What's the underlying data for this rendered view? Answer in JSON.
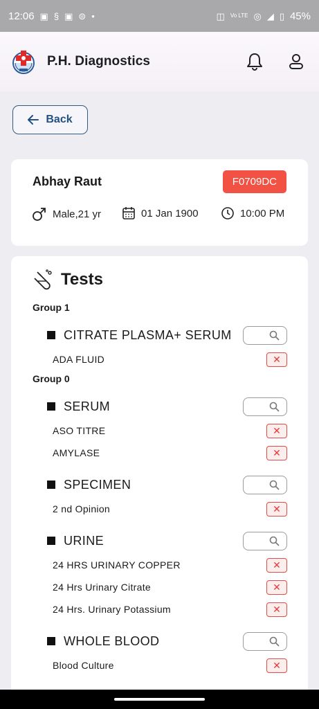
{
  "status_bar": {
    "time": "12:06",
    "battery": "45%",
    "network_label": "Vo LTE"
  },
  "app": {
    "title": "P.H. Diagnostics"
  },
  "back_label": "Back",
  "patient": {
    "name": "Abhay Raut",
    "id": "F0709DC",
    "gender_age": "Male,21 yr",
    "date": "01 Jan 1900",
    "time": "10:00 PM"
  },
  "tests": {
    "title": "Tests",
    "groups": [
      {
        "label": "Group 1",
        "samples": [
          {
            "name": "CITRATE PLASMA+ SERUM",
            "tests": [
              "ADA FLUID"
            ]
          }
        ]
      },
      {
        "label": "Group 0",
        "samples": [
          {
            "name": "SERUM",
            "tests": [
              "ASO TITRE",
              "AMYLASE"
            ]
          },
          {
            "name": "SPECIMEN",
            "tests": [
              "2 nd Opinion"
            ]
          },
          {
            "name": "URINE",
            "tests": [
              "24 HRS URINARY COPPER",
              "24 Hrs Urinary Citrate",
              "24 Hrs. Urinary Potassium"
            ]
          },
          {
            "name": "WHOLE BLOOD",
            "tests": [
              "Blood Culture"
            ]
          }
        ]
      }
    ]
  },
  "colors": {
    "accent": "#22507f",
    "id_badge": "#f25244",
    "remove": "#e64a44"
  }
}
